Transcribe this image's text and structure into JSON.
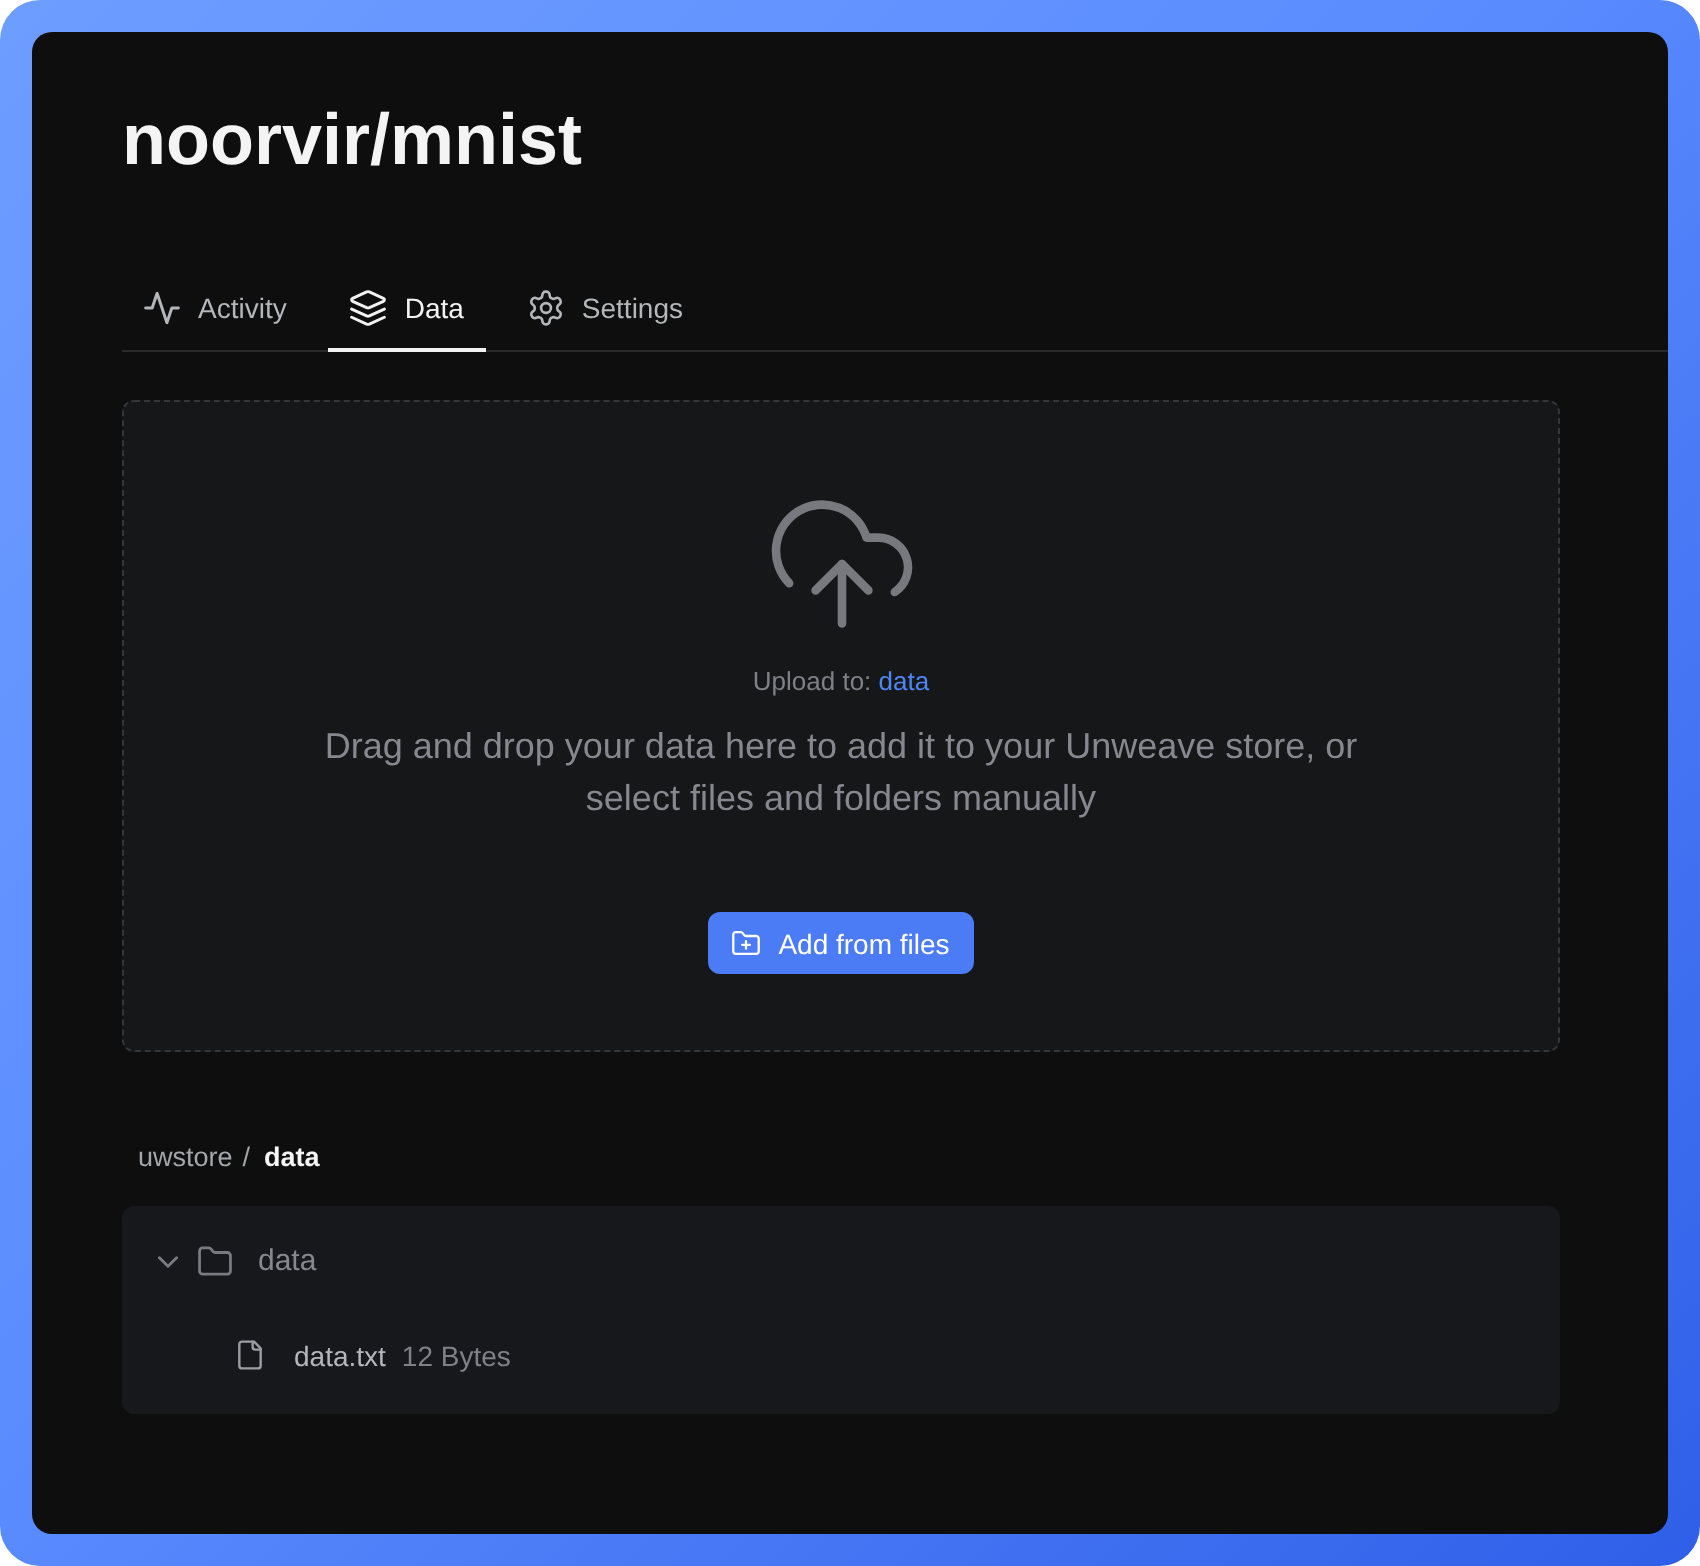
{
  "window": {
    "title": "noorvir/mnist"
  },
  "tabs": [
    {
      "label": "Activity",
      "selected": false
    },
    {
      "label": "Data",
      "selected": true
    },
    {
      "label": "Settings",
      "selected": false
    }
  ],
  "upload": {
    "destination_label": "Upload to:",
    "destination": "data",
    "message": "Drag and drop your data here to add it to your Unweave store, or select files and folders manually",
    "button": "Add from files"
  },
  "breadcrumb": {
    "separator": "/",
    "items": [
      {
        "label": "uwstore",
        "selected": false
      },
      {
        "label": "data",
        "selected": true
      }
    ]
  },
  "tree": [
    {
      "kind": "folder",
      "name": "data",
      "expanded": true,
      "children": [
        {
          "kind": "file",
          "name": "data.txt",
          "size": "12 Bytes"
        }
      ]
    }
  ]
}
